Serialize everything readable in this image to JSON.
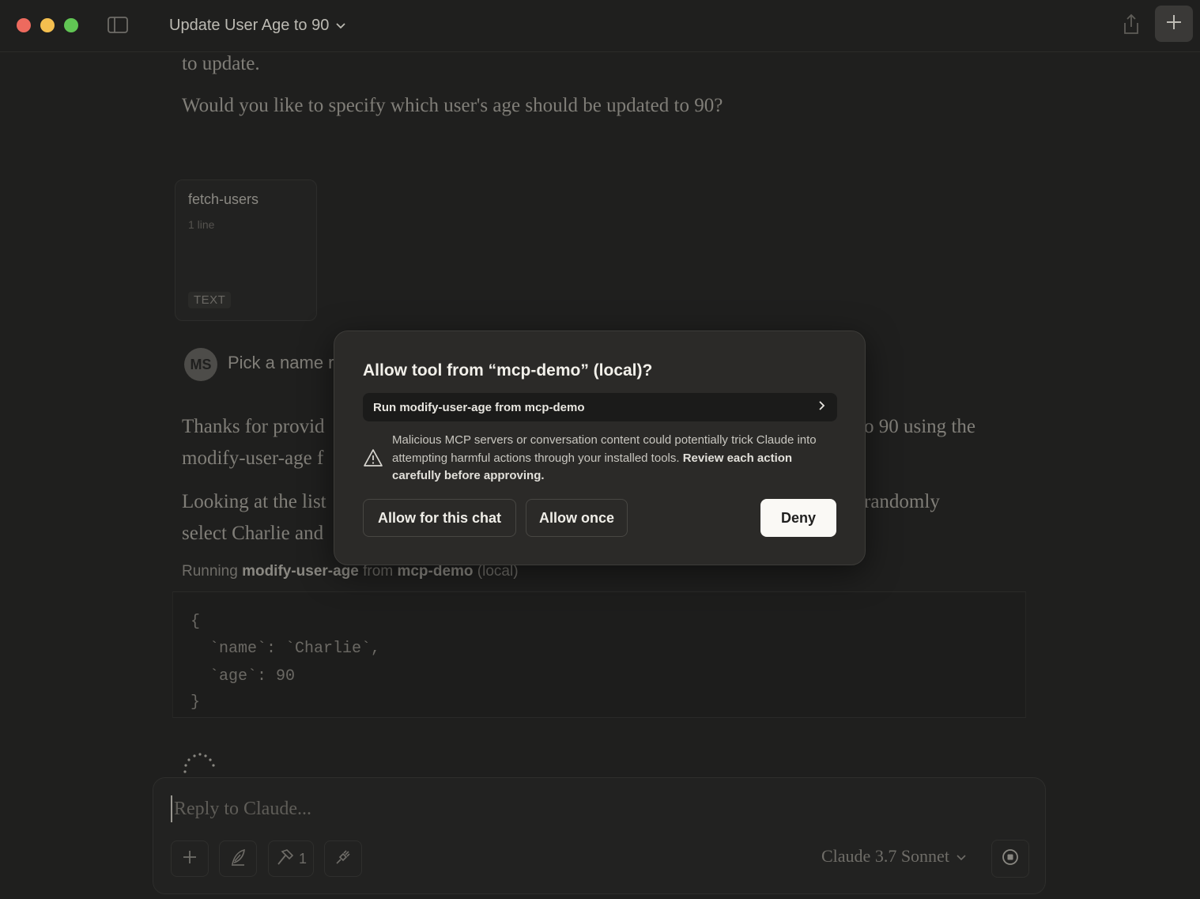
{
  "window": {
    "title": "Update User Age to 90"
  },
  "conversation": {
    "assistant_tail": "to update.",
    "assistant_question": "Would you like to specify which user's age should be updated to 90?",
    "file": {
      "name": "fetch-users",
      "meta": "1 line",
      "type": "TEXT"
    },
    "user": {
      "initials": "MS",
      "message": "Pick a name r"
    },
    "reply_p1_line1_left": "Thanks for provid",
    "reply_p1_line1_right": "o 90 using the",
    "reply_p1_line2": "modify-user-age f",
    "reply_p2_line1_left": "Looking at the list",
    "reply_p2_line1_right": "randomly",
    "reply_p2_line2": "select Charlie and",
    "running": {
      "prefix": "Running",
      "tool": "modify-user-age",
      "from": "from",
      "server": "mcp-demo",
      "scope": "(local)"
    },
    "code_lines": [
      "{",
      "  `name`: `Charlie`,",
      "  `age`: 90",
      "}"
    ]
  },
  "composer": {
    "placeholder": "Reply to Claude...",
    "tools_count": "1",
    "model": "Claude 3.7 Sonnet"
  },
  "modal": {
    "title": "Allow tool from “mcp-demo” (local)?",
    "run_label": "Run modify-user-age from mcp-demo",
    "warning": "Malicious MCP servers or conversation content could potentially trick Claude into attempting harmful actions through your installed tools.",
    "warning_bold": "Review each action carefully before approving.",
    "allow_chat": "Allow for this chat",
    "allow_once": "Allow once",
    "deny": "Deny"
  },
  "icons": [
    "sidebar-toggle-icon",
    "chevron-down-icon",
    "share-icon",
    "plus-icon",
    "chevron-right-icon",
    "warning-icon",
    "feather-icon",
    "hammer-icon",
    "plug-icon",
    "stop-icon",
    "spinner-icon"
  ]
}
